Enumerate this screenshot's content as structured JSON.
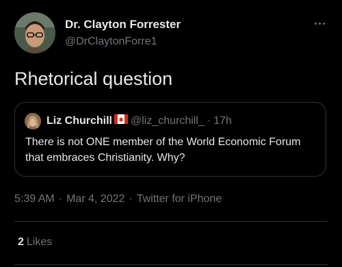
{
  "author": {
    "name": "Dr. Clayton Forrester",
    "handle": "@DrClaytonForre1"
  },
  "tweet": {
    "text": "Rhetorical question"
  },
  "quoted_tweet": {
    "name": "Liz Churchill",
    "flag": "canada-flag-icon",
    "handle": "@liz_churchill_",
    "separator": "·",
    "time": "17h",
    "text": "There is not ONE member of the World Economic Forum that embraces Christianity. Why?"
  },
  "meta": {
    "time": "5:39 AM",
    "sep1": "·",
    "date": "Mar 4, 2022",
    "sep2": "·",
    "source": "Twitter for iPhone"
  },
  "stats": {
    "likes_count": "2",
    "likes_label": "Likes"
  },
  "colors": {
    "background": "#000000",
    "text": "#e7e9ea",
    "secondary": "#71767b",
    "border": "#2f3336"
  }
}
